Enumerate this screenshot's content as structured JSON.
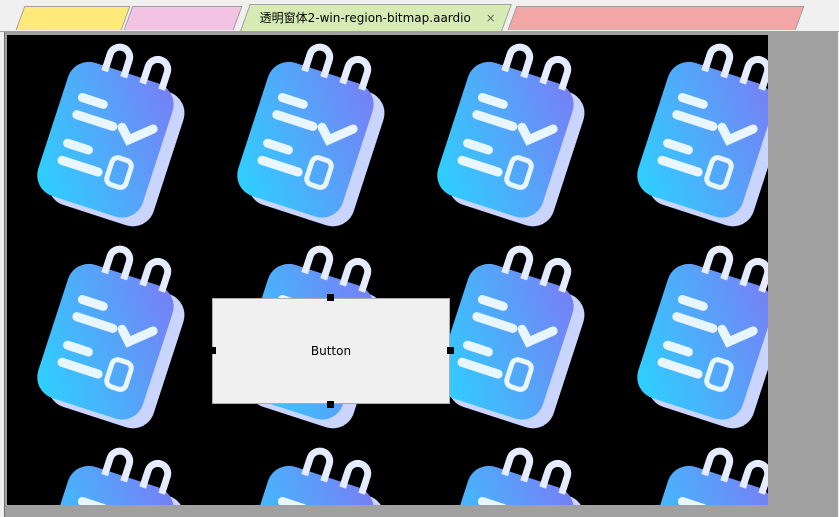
{
  "tabs": [
    {
      "label": "",
      "color": "#ffe97a",
      "blurred": true
    },
    {
      "label": "",
      "color": "#f3c3e3",
      "blurred": true
    },
    {
      "label": "透明窗体2-win-region-bitmap.aardio",
      "color": "#d6ecb4",
      "active": true,
      "close": "×"
    },
    {
      "label": "",
      "color": "#f3a6a6",
      "blurred": true
    }
  ],
  "canvas": {
    "background": "#000000",
    "tile_icon": "checklist-notepad-icon"
  },
  "button": {
    "label": "Button"
  }
}
